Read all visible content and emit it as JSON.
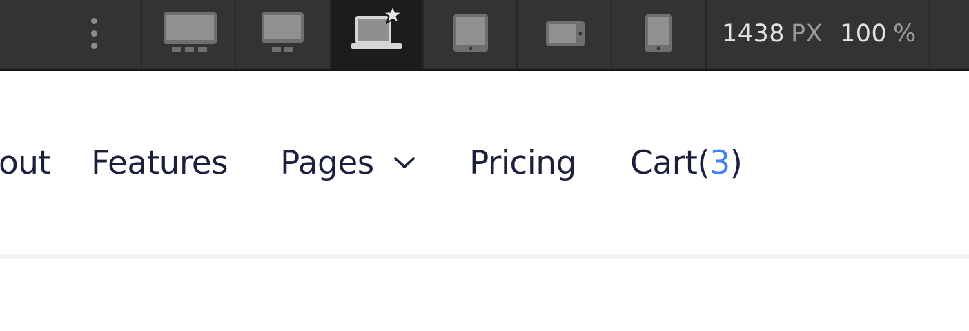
{
  "toolbar": {
    "width_value": "1438",
    "width_unit": "PX",
    "zoom_value": "100",
    "zoom_unit": "%",
    "devices": [
      {
        "name": "desktop-large",
        "active": false
      },
      {
        "name": "desktop",
        "active": false
      },
      {
        "name": "laptop-base",
        "active": true
      },
      {
        "name": "tablet-landscape",
        "active": false
      },
      {
        "name": "mobile-landscape",
        "active": false
      },
      {
        "name": "mobile-portrait",
        "active": false
      }
    ]
  },
  "nav": {
    "about": "out",
    "features": "Features",
    "pages": "Pages",
    "pricing": "Pricing",
    "cart_prefix": "Cart(",
    "cart_count": "3",
    "cart_suffix": ")"
  },
  "colors": {
    "toolbar_bg": "#333333",
    "active_bg": "#1c1c1c",
    "nav_text": "#1b1f3b",
    "accent": "#3f82f7"
  }
}
